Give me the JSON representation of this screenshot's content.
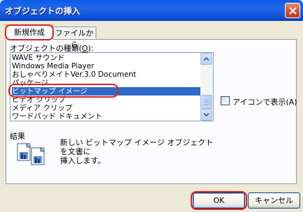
{
  "window": {
    "title": "オブジェクトの挿入"
  },
  "tabs": [
    {
      "label": "新規作成",
      "active": true
    },
    {
      "label": "ファイルから",
      "active": false
    }
  ],
  "object_list": {
    "label_prefix": "オブジェクトの種類(",
    "label_key": "O",
    "label_suffix": "):",
    "items": [
      "WAVE サウンド",
      "Windows Media Player",
      "おしゃべりメイトVer.3.0 Document",
      "パッケージ",
      "ビットマップ イメージ",
      "ビデオ クリップ",
      "メディア クリップ",
      "ワードパッド ドキュメント"
    ],
    "selected_index": 4
  },
  "display_as_icon": {
    "label": "アイコンで表示(A)",
    "checked": false
  },
  "result": {
    "label": "結果",
    "line1": "新しい ビットマップ イメージ オブジェクトを文書に",
    "line2": "挿入します。"
  },
  "buttons": {
    "ok": "OK",
    "cancel": "キャンセル"
  },
  "colors": {
    "accent": "#316ac5",
    "highlight_annotation": "#e02020",
    "title_bar": "#0a5ee8"
  }
}
